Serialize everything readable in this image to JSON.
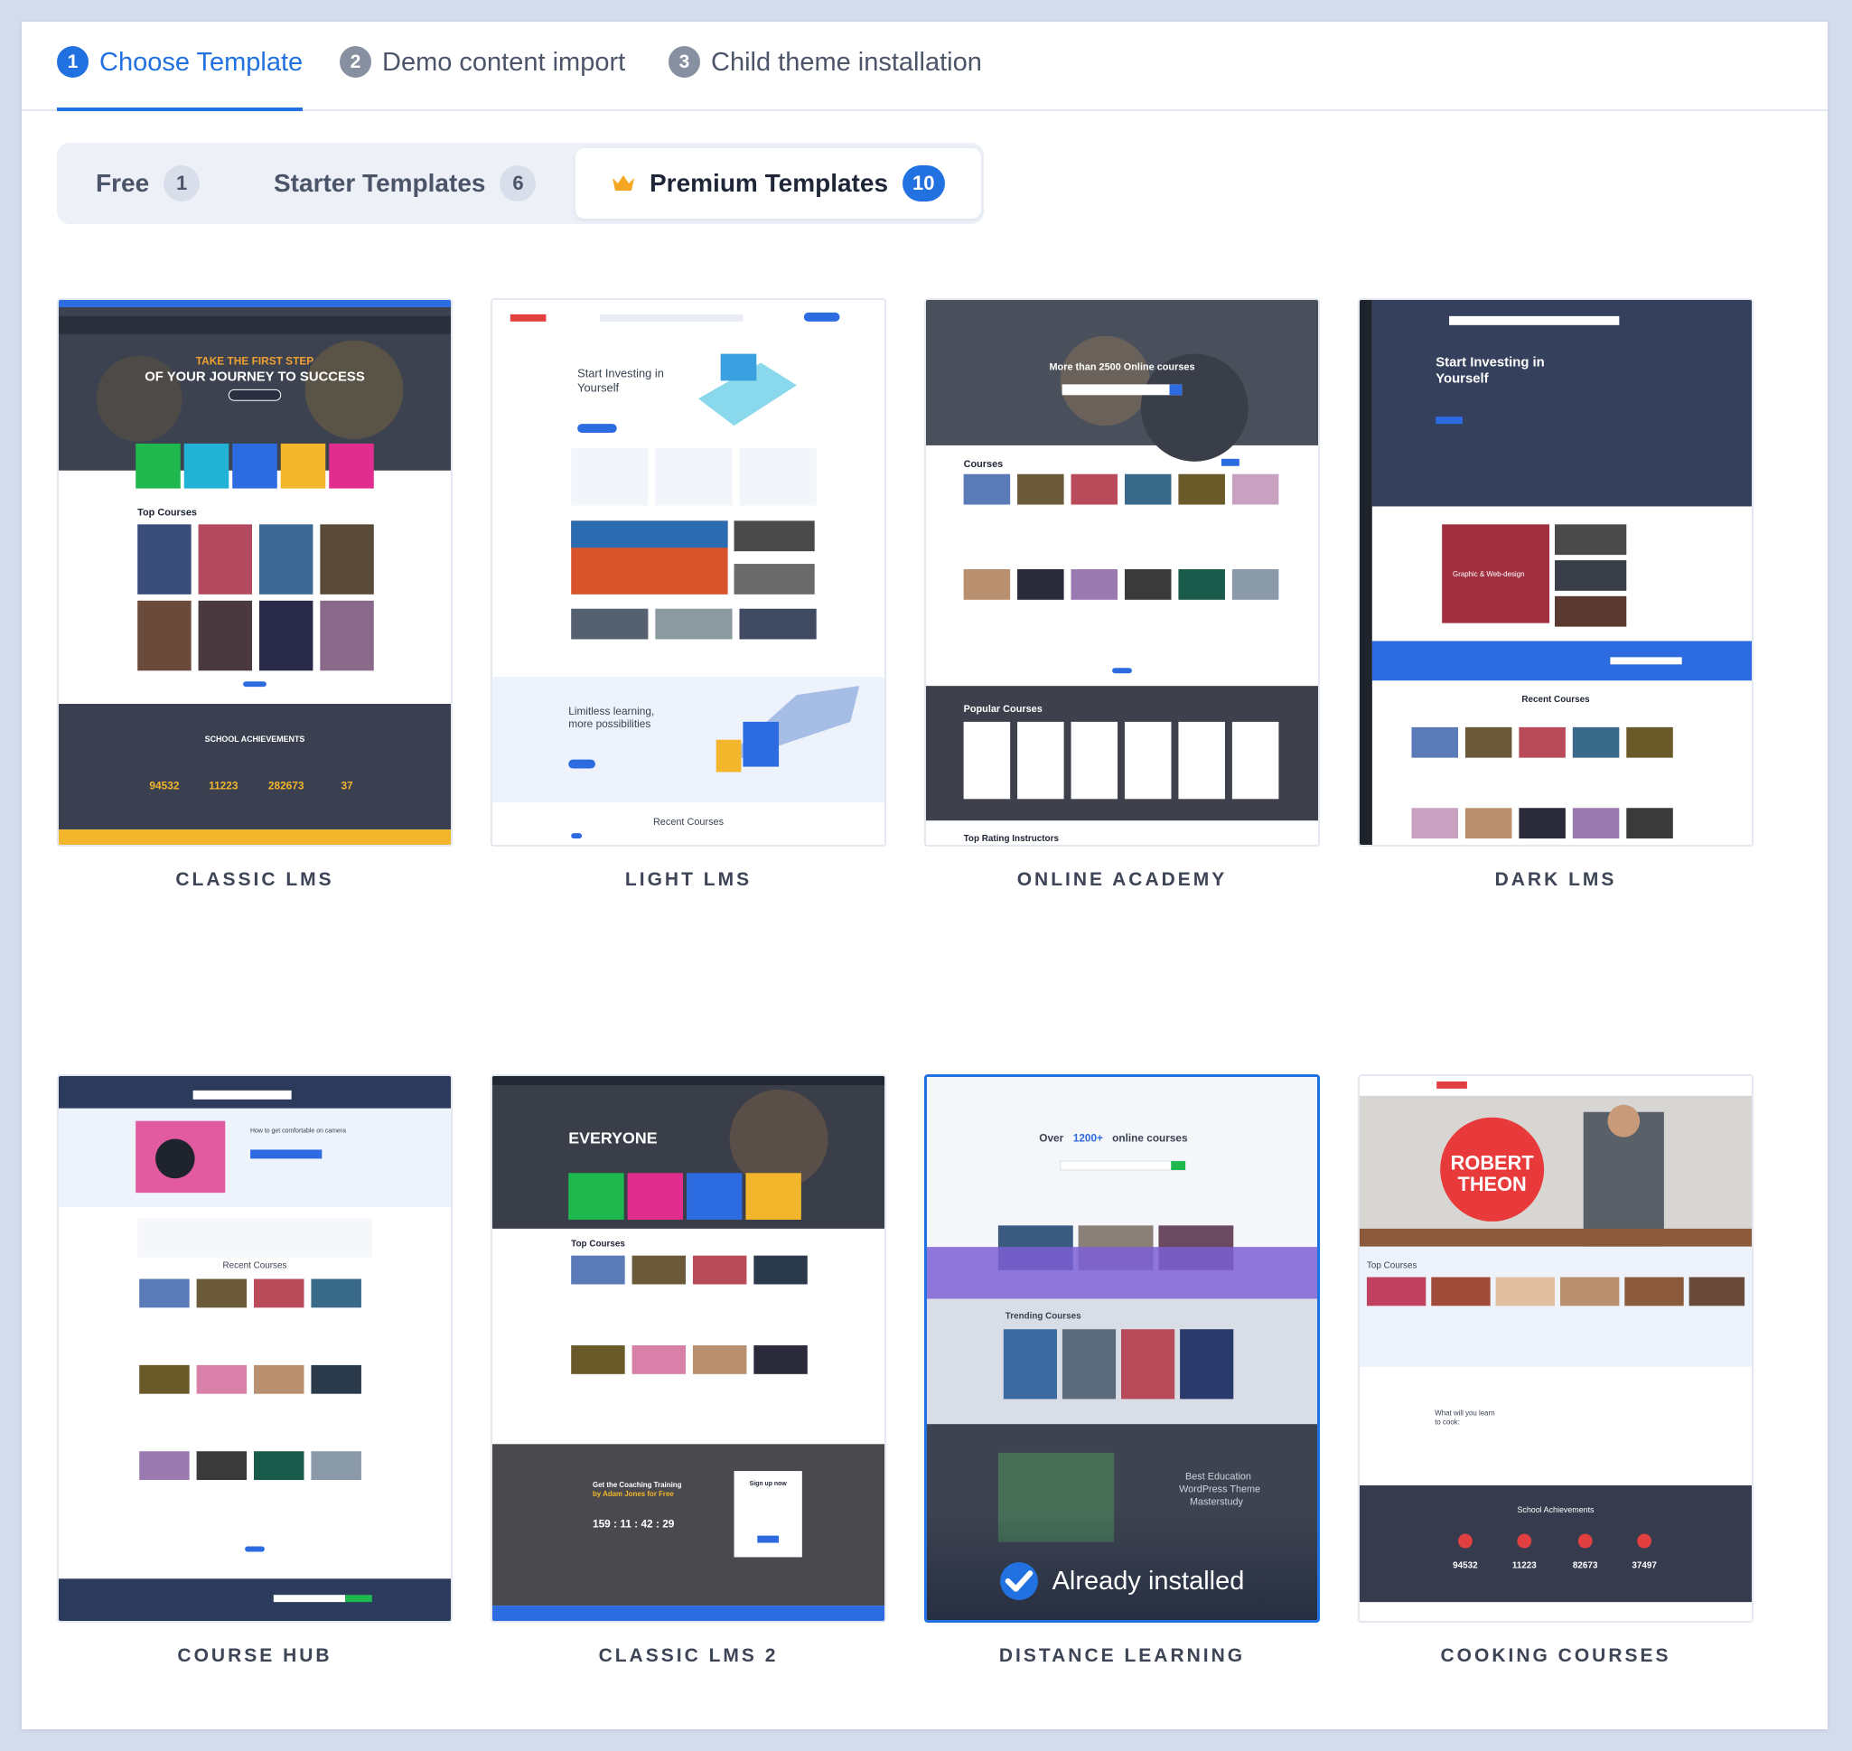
{
  "steps": [
    {
      "num": "1",
      "label": "Choose Template"
    },
    {
      "num": "2",
      "label": "Demo content import"
    },
    {
      "num": "3",
      "label": "Child theme installation"
    }
  ],
  "tabs": [
    {
      "label": "Free",
      "count": "1"
    },
    {
      "label": "Starter Templates",
      "count": "6"
    },
    {
      "label": "Premium Templates",
      "count": "10",
      "icon": "crown-icon"
    }
  ],
  "templates": [
    {
      "name": "CLASSIC LMS"
    },
    {
      "name": "LIGHT LMS"
    },
    {
      "name": "ONLINE ACADEMY"
    },
    {
      "name": "DARK LMS"
    },
    {
      "name": "COURSE HUB"
    },
    {
      "name": "CLASSIC LMS 2"
    },
    {
      "name": "DISTANCE LEARNING",
      "status": "Already installed"
    },
    {
      "name": "COOKING COURSES"
    }
  ],
  "previews": {
    "classic_lms": {
      "hero_1": "TAKE THE FIRST STEP",
      "hero_2": "OF YOUR JOURNEY TO SUCCESS",
      "section": "Top Courses",
      "achievements": "SCHOOL ACHIEVEMENTS",
      "stats": [
        "94532",
        "11223",
        "282673",
        "37"
      ]
    },
    "light_lms": {
      "hero_1": "Start Investing in",
      "hero_2": "Yourself",
      "mid_1": "Limitless learning,",
      "mid_2": "more possibilities",
      "section": "Recent Courses"
    },
    "online_academy": {
      "hero": "More than 2500 Online courses",
      "section_1": "Courses",
      "section_2": "Popular Courses",
      "section_3": "Top Rating Instructors"
    },
    "dark_lms": {
      "hero_1": "Start Investing in",
      "hero_2": "Yourself",
      "tile": "Graphic & Web-design",
      "section": "Recent Courses"
    },
    "course_hub": {
      "hero": "How to get comfortable on camera",
      "section": "Recent Courses"
    },
    "classic_lms_2": {
      "hero": "EVERYONE",
      "section": "Top Courses",
      "coaching_1": "Get the Coaching Training",
      "coaching_2": "by Adam Jones for Free",
      "countdown": "159 : 11 : 42 : 29",
      "signup": "Sign up now"
    },
    "distance_learning": {
      "hero_1": "Over",
      "hero_2": "1200+",
      "hero_3": "online courses",
      "section": "Trending Courses",
      "slogan_1": "Best Education",
      "slogan_2": "WordPress Theme",
      "slogan_3": "Masterstudy"
    },
    "cooking_courses": {
      "hero_1": "ROBERT",
      "hero_2": "THEON",
      "section": "Top Courses",
      "learn_1": "What will you learn",
      "learn_2": "to cook:",
      "achievements": "School Achievements",
      "stats": [
        "94532",
        "11223",
        "82673",
        "37497"
      ]
    }
  },
  "colors": {
    "accent": "#2171e0",
    "step_inactive": "#8790a0",
    "page_bg": "#d3dbec"
  }
}
